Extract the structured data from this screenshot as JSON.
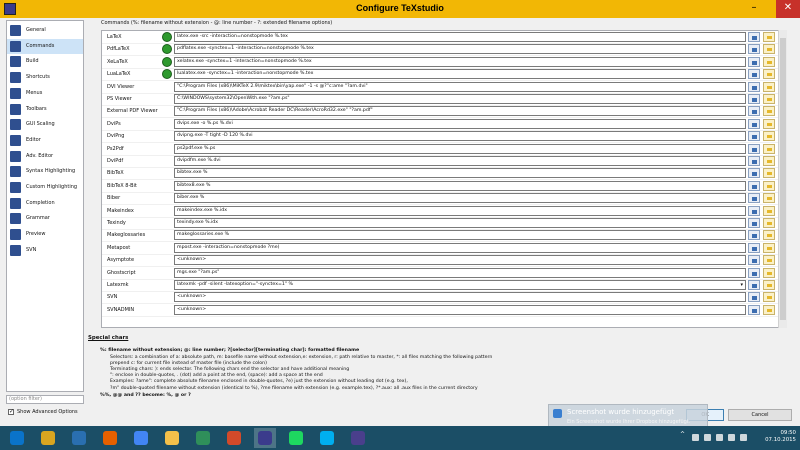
{
  "window": {
    "title": "Configure TeXstudio",
    "minimize": "–",
    "maximize": "□",
    "close": "✕"
  },
  "sidebar": {
    "items": [
      {
        "label": "General",
        "icon": "general-icon"
      },
      {
        "label": "Commands",
        "icon": "commands-icon",
        "selected": true
      },
      {
        "label": "Build",
        "icon": "build-icon"
      },
      {
        "label": "Shortcuts",
        "icon": "shortcuts-icon"
      },
      {
        "label": "Menus",
        "icon": "menus-icon"
      },
      {
        "label": "Toolbars",
        "icon": "toolbars-icon"
      },
      {
        "label": "GUI Scaling",
        "icon": "gui-scaling-icon"
      },
      {
        "label": "Editor",
        "icon": "editor-icon"
      },
      {
        "label": "Adv. Editor",
        "icon": "adv-editor-icon"
      },
      {
        "label": "Syntax Highlighting",
        "icon": "syntax-highlighting-icon"
      },
      {
        "label": "Custom Highlighting",
        "icon": "custom-highlighting-icon"
      },
      {
        "label": "Completion",
        "icon": "completion-icon"
      },
      {
        "label": "Grammar",
        "icon": "grammar-icon"
      },
      {
        "label": "Preview",
        "icon": "preview-icon"
      },
      {
        "label": "SVN",
        "icon": "svn-icon"
      }
    ],
    "filter_placeholder": "(option filter)",
    "advanced_label": "Show Advanced Options",
    "advanced_checked": "✓"
  },
  "commands": {
    "header": "Commands (%: filename without extension - @: line number - ?: extended filename options)",
    "rows": [
      {
        "label": "LaTeX",
        "value": "latex.exe -src -interaction=nonstopmode %.tex",
        "wizard": true
      },
      {
        "label": "PdfLaTeX",
        "value": "pdflatex.exe -synctex=1 -interaction=nonstopmode %.tex",
        "wizard": true
      },
      {
        "label": "XeLaTeX",
        "value": "xelatex.exe -synctex=1 -interaction=nonstopmode %.tex",
        "wizard": true
      },
      {
        "label": "LuaLaTeX",
        "value": "lualatex.exe -synctex=1 -interaction=nonstopmode %.tex",
        "wizard": true
      },
      {
        "label": "DVI Viewer",
        "value": "\"C:\\Program Files (x86)\\MiKTeX 2.9\\miktex\\bin\\yap.exe\" -1 -s @?\"c:ame \"?am.dvi\"",
        "wizard": false
      },
      {
        "label": "PS Viewer",
        "value": "C:\\WINDOWS\\system32\\OpenWith.exe \"?am.ps\"",
        "wizard": false
      },
      {
        "label": "External PDF Viewer",
        "value": "\"C:\\Program Files (x86)\\Adobe\\Acrobat Reader DC\\Reader\\AcroRd32.exe\" \"?am.pdf\"",
        "wizard": false
      },
      {
        "label": "DviPs",
        "value": "dvips.exe -o %.ps %.dvi",
        "wizard": false
      },
      {
        "label": "DviPng",
        "value": "dvipng.exe -T tight -D 120 %.dvi",
        "wizard": false
      },
      {
        "label": "Ps2Pdf",
        "value": "ps2pdf.exe %.ps",
        "wizard": false
      },
      {
        "label": "DviPdf",
        "value": "dvipdfm.exe %.dvi",
        "wizard": false
      },
      {
        "label": "BibTeX",
        "value": "bibtex.exe %",
        "wizard": false
      },
      {
        "label": "BibTeX 8-Bit",
        "value": "bibtex8.exe %",
        "wizard": false
      },
      {
        "label": "Biber",
        "value": "biber.exe %",
        "wizard": false
      },
      {
        "label": "Makeindex",
        "value": "makeindex.exe %.idx",
        "wizard": false
      },
      {
        "label": "Texindy",
        "value": "texindy.exe %.idx",
        "wizard": false
      },
      {
        "label": "Makeglossaries",
        "value": "makeglossaries.exe %",
        "wizard": false
      },
      {
        "label": "Metapost",
        "value": "mpost.exe -interaction=nonstopmode ?me)",
        "wizard": false
      },
      {
        "label": "Asymptote",
        "value": "<unknown>",
        "wizard": false
      },
      {
        "label": "Ghostscript",
        "value": "mgs.exe \"?am.ps\"",
        "wizard": false
      },
      {
        "label": "Latexmk",
        "value": "latexmk -pdf -silent -latexoption=\"-synctex=1\" %",
        "wizard": false,
        "combo": true
      },
      {
        "label": "SVN",
        "value": "<unknown>",
        "wizard": false
      },
      {
        "label": "SVNADMIN",
        "value": "<unknown>",
        "wizard": false
      }
    ]
  },
  "special": {
    "title": "Special chars",
    "lines": [
      "%: filename without extension; @: line number; ?[selector][terminating char]: formatted filename",
      "Selectors: a combination of a: absolute path, m: basefile name without extension,e: extension, r: path relative to master, *: all files matching the following pattern",
      "prepend c: for current file instead of master file (include the colon)",
      "Terminating chars: ): ends selector. The following chars end the selector and have additional meaning",
      "\": enclose in double-quotes, . (dot) add a point at the end, (space): add a space at the end",
      "Examples: ?ame\": complete absolute filename enclosed in double-quotes, ?e) just the extension without leading dot (e.g. tex),",
      "?m\" double-quoted filename without extension (identical to %), ?me filename with extension (e.g. example.tex), ?*.aux: all .aux files in the current directory",
      "%%, @@ and ?? become: %, @ or ?"
    ]
  },
  "buttons": {
    "ok": "OK",
    "cancel": "Cancel"
  },
  "toast": {
    "title": "Screenshot wurde hinzugefügt",
    "text": "Ein Screenshot wurde Ihrer Dropbox hinzugefügt."
  },
  "taskbar": {
    "apps": [
      "windows-start-icon",
      "file-explorer-icon",
      "paint-icon",
      "firefox-icon",
      "chrome-icon",
      "folder-icon",
      "tool-icon",
      "matlab-icon",
      "texstudio-icon",
      "spotify-icon",
      "skype-icon",
      "texstudio-alt-icon"
    ],
    "tray_chevron": "^",
    "time": "09:50",
    "date": "07.10.2015"
  }
}
